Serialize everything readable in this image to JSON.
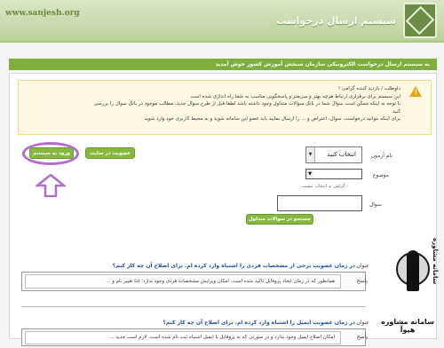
{
  "header": {
    "site_url": "www.sanjesh.org",
    "title": "سیستم ارسال درخواست"
  },
  "banner": {
    "text": "به سیستم ارسال درخواست الکترونیکی سازمان سنجش آموزش کشور خوش آمدید"
  },
  "notice": {
    "greeting": "داوطلب / بازدید کننده گرامی !",
    "line1": "این سیستم برای برقراری ارتباط هرچه بهتر و سریعتر و پاسخگویی مناسب به شما راه اندازی شده است",
    "line2": "با توجه به اینکه ممکن است سوال شما در بانک سوالات متداول وجود داشته باشد لطفا قبل از طرح سوال جدید، مطالب موجود در بانک سوال را بررسی",
    "line3": "کنید",
    "line4": "برای اینکه بتوانید درخواست، سوال، اعتراض و ... را ارسال نمایید باید عضو این سامانه شوید و به محیط کاربری خود وارد شوید"
  },
  "form": {
    "department_label": "نام آزمون",
    "department_value": "انتخاب کنید",
    "subject_label": "موضوع",
    "subject_hint": "- گرامی به انتخاب نیست.",
    "question_label": "سوال",
    "faq_search_button": "جستجو در سوالات متداول",
    "membership_button": "عضویت در سایت",
    "login_button": "ورود به سیستم"
  },
  "faq": [
    {
      "title_label": "عنوان",
      "question": "در زمان عضویت برخی از مشخصات فردی را اشتباه وارد کرده ام. برای اصلاح آن چه کار کنم؟",
      "answer_label": "پاسخ",
      "answer": "همانطور که در زمان ایجاد پروفایل تاکید شده است، امکان ویرایش مشخصات فردی وجود ندارد؛ لذا تغییر نام و ..."
    },
    {
      "title_label": "عنوان",
      "question": "در زمان عضویت ایمیل را اشتباه وارد کرده ام. برای اصلاح آن چه کار کنم؟",
      "answer_label": "پاسخ",
      "answer": "امکان اصلاح ایمیل وجود ندارد و در صورتی که به پروفایل با ایمیل اشتباه ثبت نام شده است، لازم است جدید ..."
    }
  ],
  "watermark": {
    "vertical_text": "سامانه مشاوره",
    "bottom_text": "سامانه مشاوره هپوآ"
  },
  "colors": {
    "header_green": "#c7dbad",
    "banner_green": "#7fae3f",
    "button_green": "#86b83f",
    "highlight_purple": "#b36cc9",
    "warning_orange": "#e8a317"
  }
}
